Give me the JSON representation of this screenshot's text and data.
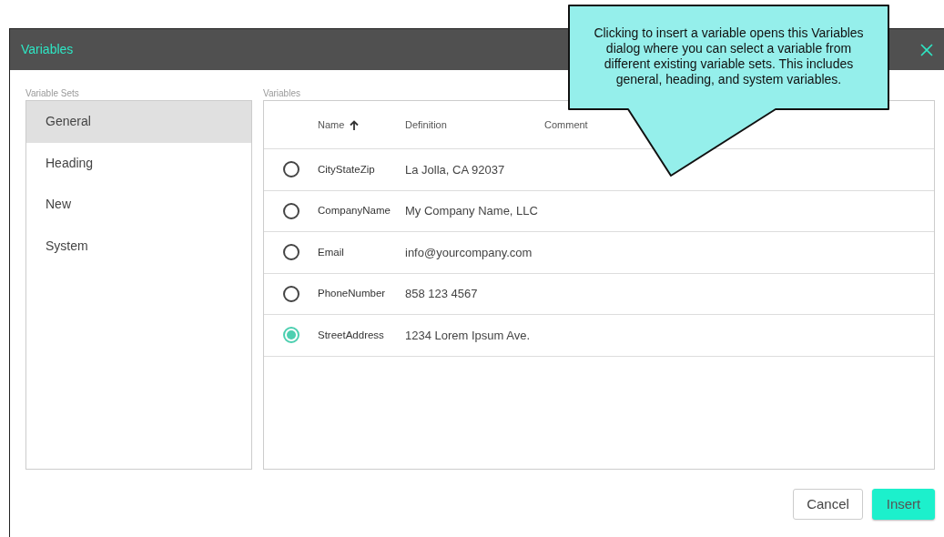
{
  "dialog": {
    "title": "Variables"
  },
  "variable_sets": {
    "label": "Variable Sets",
    "items": [
      {
        "label": "General",
        "selected": true
      },
      {
        "label": "Heading",
        "selected": false
      },
      {
        "label": "New",
        "selected": false
      },
      {
        "label": "System",
        "selected": false
      }
    ]
  },
  "variables": {
    "label": "Variables",
    "columns": [
      {
        "label": "Name",
        "sorted": true
      },
      {
        "label": "Definition",
        "sorted": false
      },
      {
        "label": "Comment",
        "sorted": false
      }
    ],
    "rows": [
      {
        "name": "CityStateZip",
        "definition": "La Jolla, CA 92037",
        "selected": false
      },
      {
        "name": "CompanyName",
        "definition": "My Company Name, LLC",
        "selected": false
      },
      {
        "name": "Email",
        "definition": "info@yourcompany.com",
        "selected": false
      },
      {
        "name": "PhoneNumber",
        "definition": "858 123 4567",
        "selected": false
      },
      {
        "name": "StreetAddress",
        "definition": "1234 Lorem Ipsum Ave.",
        "selected": true
      }
    ]
  },
  "buttons": [
    {
      "label": "Cancel",
      "kind": "secondary"
    },
    {
      "label": "Insert",
      "kind": "primary"
    }
  ],
  "callout": {
    "text": "Clicking to insert a variable opens this Variables dialog where you can select a variable from different existing variable sets. This includes general, heading, and system variables."
  }
}
